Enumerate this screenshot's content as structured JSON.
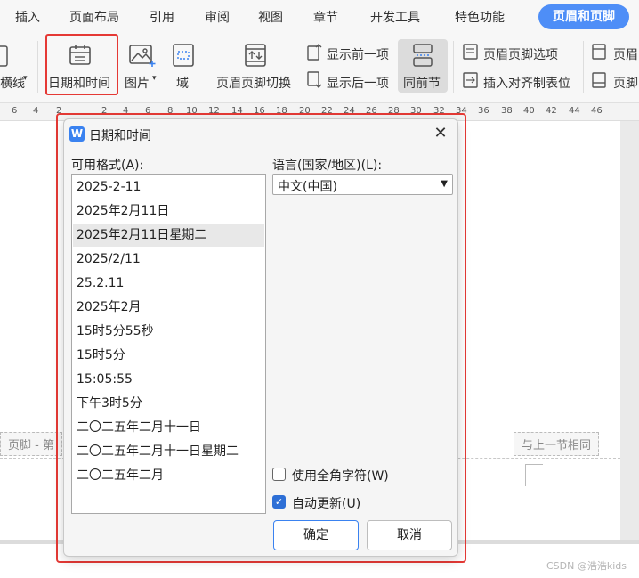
{
  "menu": {
    "tabs": [
      "插入",
      "页面布局",
      "引用",
      "审阅",
      "视图",
      "章节",
      "开发工具",
      "特色功能"
    ],
    "active_tab": "页眉和页脚"
  },
  "ribbon": {
    "partial_left_label": "横线",
    "date_time": "日期和时间",
    "picture": "图片",
    "field": "域",
    "header_footer_switch": "页眉页脚切换",
    "show_previous": "显示前一项",
    "show_next": "显示后一项",
    "same_as_previous": "同前节",
    "header_footer_options": "页眉页脚选项",
    "insert_alignment_tab": "插入对齐制表位",
    "partial_right_1": "页眉",
    "partial_right_2": "页脚"
  },
  "ruler": {
    "ticks": [
      "6",
      "4",
      "2",
      "2",
      "4",
      "6",
      "8",
      "10",
      "12",
      "14",
      "16",
      "18",
      "20",
      "22",
      "24",
      "26",
      "28",
      "30",
      "32",
      "34",
      "36",
      "38",
      "40",
      "42",
      "44",
      "46"
    ]
  },
  "document": {
    "footer_label": "页脚  - 第",
    "same_as_previous_tag": "与上一节相同",
    "watermark": "CSDN @浩浩kids"
  },
  "dialog": {
    "title": "日期和时间",
    "close": "✕",
    "formats_label": "可用格式(A):",
    "formats": [
      "2025-2-11",
      "2025年2月11日",
      "2025年2月11日星期二",
      "2025/2/11",
      "25.2.11",
      "2025年2月",
      "15时5分55秒",
      "15时5分",
      "15:05:55",
      "下午3时5分",
      "二〇二五年二月十一日",
      "二〇二五年二月十一日星期二",
      "二〇二五年二月"
    ],
    "selected_format_index": 2,
    "language_label": "语言(国家/地区)(L):",
    "language_value": "中文(中国)",
    "fullwidth_label": "使用全角字符(W)",
    "fullwidth_checked": false,
    "auto_update_label": "自动更新(U)",
    "auto_update_checked": true,
    "ok": "确定",
    "cancel": "取消"
  }
}
